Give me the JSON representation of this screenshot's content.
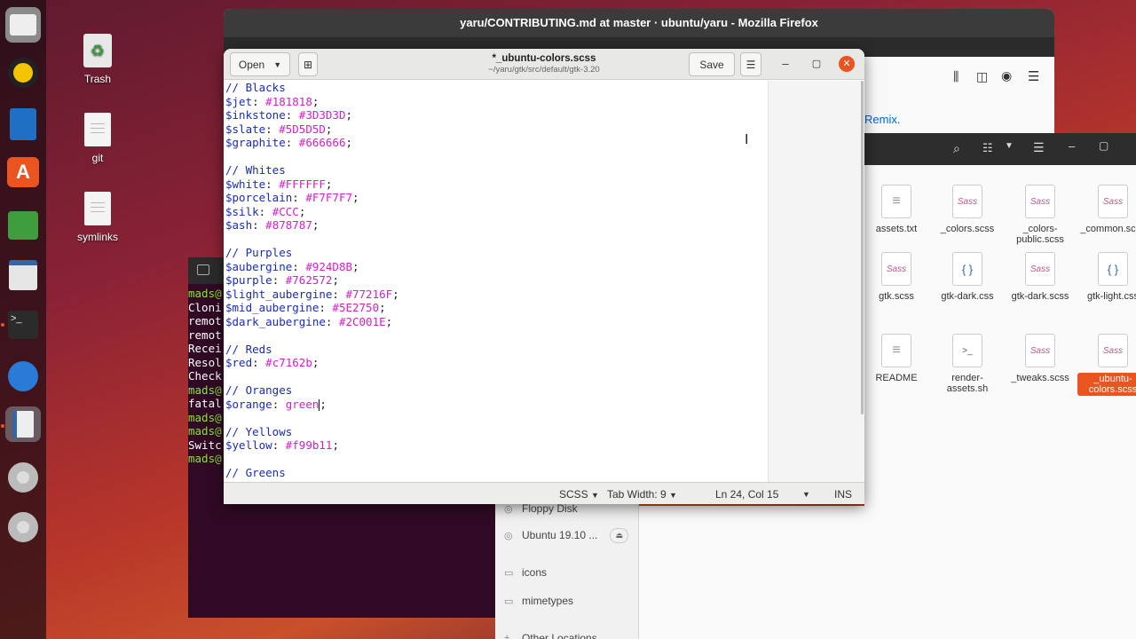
{
  "desktop": {
    "icons": [
      {
        "label": "Trash"
      },
      {
        "label": "git"
      },
      {
        "label": "symlinks"
      }
    ]
  },
  "firefox": {
    "title": "yaru/CONTRIBUTING.md at master · ubuntu/yaru - Mozilla Firefox",
    "link_text": "Remix."
  },
  "nautilus": {
    "files": [
      {
        "name": "assets.txt",
        "icon": "text-file-icon"
      },
      {
        "name": "_colors.scss",
        "icon": "sass-file-icon"
      },
      {
        "name": "_colors-public.scss",
        "icon": "sass-file-icon"
      },
      {
        "name": "_common.scss",
        "icon": "sass-file-icon"
      },
      {
        "name": "gtk.scss",
        "icon": "sass-file-icon"
      },
      {
        "name": "gtk-dark.css",
        "icon": "css-file-icon"
      },
      {
        "name": "gtk-dark.scss",
        "icon": "sass-file-icon"
      },
      {
        "name": "gtk-light.css",
        "icon": "css-file-icon"
      },
      {
        "name": "README",
        "icon": "text-file-icon"
      },
      {
        "name": "render-assets.sh",
        "icon": "script-file-icon"
      },
      {
        "name": "_tweaks.scss",
        "icon": "sass-file-icon"
      },
      {
        "name": "_ubuntu-colors.scss",
        "icon": "sass-file-icon"
      }
    ],
    "sidebar": [
      "Floppy Disk",
      "Ubuntu 19.10 ...",
      "icons",
      "mimetypes",
      "Other Locations"
    ]
  },
  "terminal": {
    "lines": [
      "mads@",
      "Cloni",
      "remot",
      "remot",
      "Recei",
      "Resol",
      "Check",
      "mads@",
      "fatal",
      "mads@",
      "mads@",
      "Switc",
      "mads@"
    ]
  },
  "gedit": {
    "open_label": "Open",
    "save_label": "Save",
    "filename": "*_ubuntu-colors.scss",
    "path": "~/yaru/gtk/src/default/gtk-3.20",
    "status": {
      "language": "SCSS",
      "tab_width": "Tab Width: 9",
      "position": "Ln 24, Col 15",
      "mode": "INS"
    },
    "code": [
      {
        "c": "// Blacks"
      },
      {
        "v": "$jet",
        "x": "#181818"
      },
      {
        "v": "$inkstone",
        "x": "#3D3D3D"
      },
      {
        "v": "$slate",
        "x": "#5D5D5D"
      },
      {
        "v": "$graphite",
        "x": "#666666"
      },
      {},
      {
        "c": "// Whites"
      },
      {
        "v": "$white",
        "x": "#FFFFFF"
      },
      {
        "v": "$porcelain",
        "x": "#F7F7F7"
      },
      {
        "v": "$silk",
        "x": "#CCC"
      },
      {
        "v": "$ash",
        "x": "#878787"
      },
      {},
      {
        "c": "// Purples"
      },
      {
        "v": "$aubergine",
        "x": "#924D8B"
      },
      {
        "v": "$purple",
        "x": "#762572"
      },
      {
        "v": "$light_aubergine",
        "x": "#77216F"
      },
      {
        "v": "$mid_aubergine",
        "x": "#5E2750"
      },
      {
        "v": "$dark_aubergine",
        "x": "#2C001E"
      },
      {},
      {
        "c": "// Reds"
      },
      {
        "v": "$red",
        "x": "#c7162b"
      },
      {},
      {
        "c": "// Oranges"
      },
      {
        "v": "$orange",
        "x": "green"
      },
      {},
      {
        "c": "// Yellows"
      },
      {
        "v": "$yellow",
        "x": "#f99b11"
      },
      {},
      {
        "c": "// Greens"
      }
    ]
  }
}
